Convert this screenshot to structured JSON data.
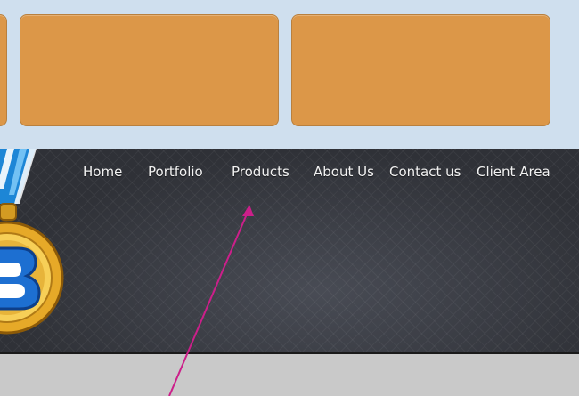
{
  "nav": {
    "items": [
      {
        "label": "Home"
      },
      {
        "label": "Portfolio"
      },
      {
        "label": "Products"
      },
      {
        "label": "About Us"
      },
      {
        "label": "Contact us"
      },
      {
        "label": "Client Area"
      }
    ]
  },
  "icons": {
    "medal": "medal-badge-icon",
    "arrow": "annotation-arrow"
  },
  "colors": {
    "top_background": "#cfdfee",
    "panel": "#dc9748",
    "header": "#2f3137",
    "nav_text": "#f2f2f2",
    "annotation_arrow": "#cc1f8a",
    "footer": "#c9c9c9"
  }
}
